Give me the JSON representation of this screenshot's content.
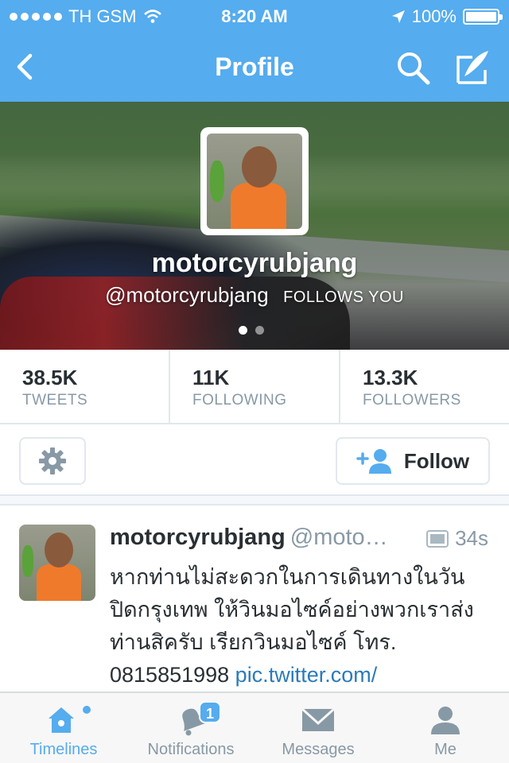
{
  "status_bar": {
    "carrier": "TH GSM",
    "time": "8:20 AM",
    "battery": "100%"
  },
  "nav": {
    "title": "Profile"
  },
  "profile": {
    "display_name": "motorcyrubjang",
    "handle": "@motorcyrubjang",
    "follows_you": "FOLLOWS YOU",
    "pages": 2,
    "current_page": 1
  },
  "stats": [
    {
      "value": "38.5K",
      "label": "TWEETS"
    },
    {
      "value": "11K",
      "label": "FOLLOWING"
    },
    {
      "value": "13.3K",
      "label": "FOLLOWERS"
    }
  ],
  "actions": {
    "follow_label": "Follow"
  },
  "tweet": {
    "name": "motorcyrubjang",
    "handle": "@moto…",
    "time": "34s",
    "text": "หากท่านไม่สะดวกในการเดินทางในวันปิดกรุงเทพ ให้วินมอไซค์อย่างพวกเราส่งท่านสิครับ เรียกวินมอไซค์ โทร. 0815851998 ",
    "link": "pic.twitter.com/"
  },
  "tabbar": {
    "items": [
      {
        "label": "Timelines",
        "icon": "home-icon",
        "active": true
      },
      {
        "label": "Notifications",
        "icon": "bell-icon",
        "badge": "1"
      },
      {
        "label": "Messages",
        "icon": "envelope-icon"
      },
      {
        "label": "Me",
        "icon": "person-icon"
      }
    ]
  },
  "colors": {
    "brand": "#55acee",
    "link": "#2b7bb9",
    "muted": "#8899a6"
  }
}
